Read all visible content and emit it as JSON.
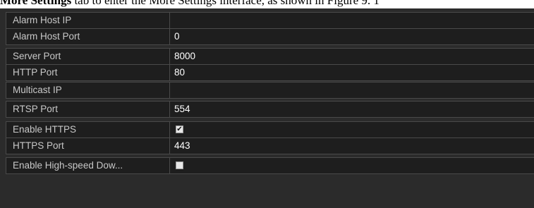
{
  "caption": {
    "prefix": "More Settings",
    "text": " tab to enter the More Settings interface, as shown in Figure 9. 1"
  },
  "settings": {
    "alarm_host_ip": {
      "label": "Alarm Host IP",
      "value": ""
    },
    "alarm_host_port": {
      "label": "Alarm Host Port",
      "value": "0"
    },
    "server_port": {
      "label": "Server Port",
      "value": "8000"
    },
    "http_port": {
      "label": "HTTP Port",
      "value": "80"
    },
    "multicast_ip": {
      "label": "Multicast IP",
      "value": ""
    },
    "rtsp_port": {
      "label": "RTSP Port",
      "value": "554"
    },
    "enable_https": {
      "label": "Enable HTTPS",
      "checked": true
    },
    "https_port": {
      "label": "HTTPS Port",
      "value": "443"
    },
    "enable_high_speed_download": {
      "label": "Enable High-speed Dow...",
      "checked": false
    }
  },
  "icons": {
    "checked": "checkmark-icon"
  }
}
